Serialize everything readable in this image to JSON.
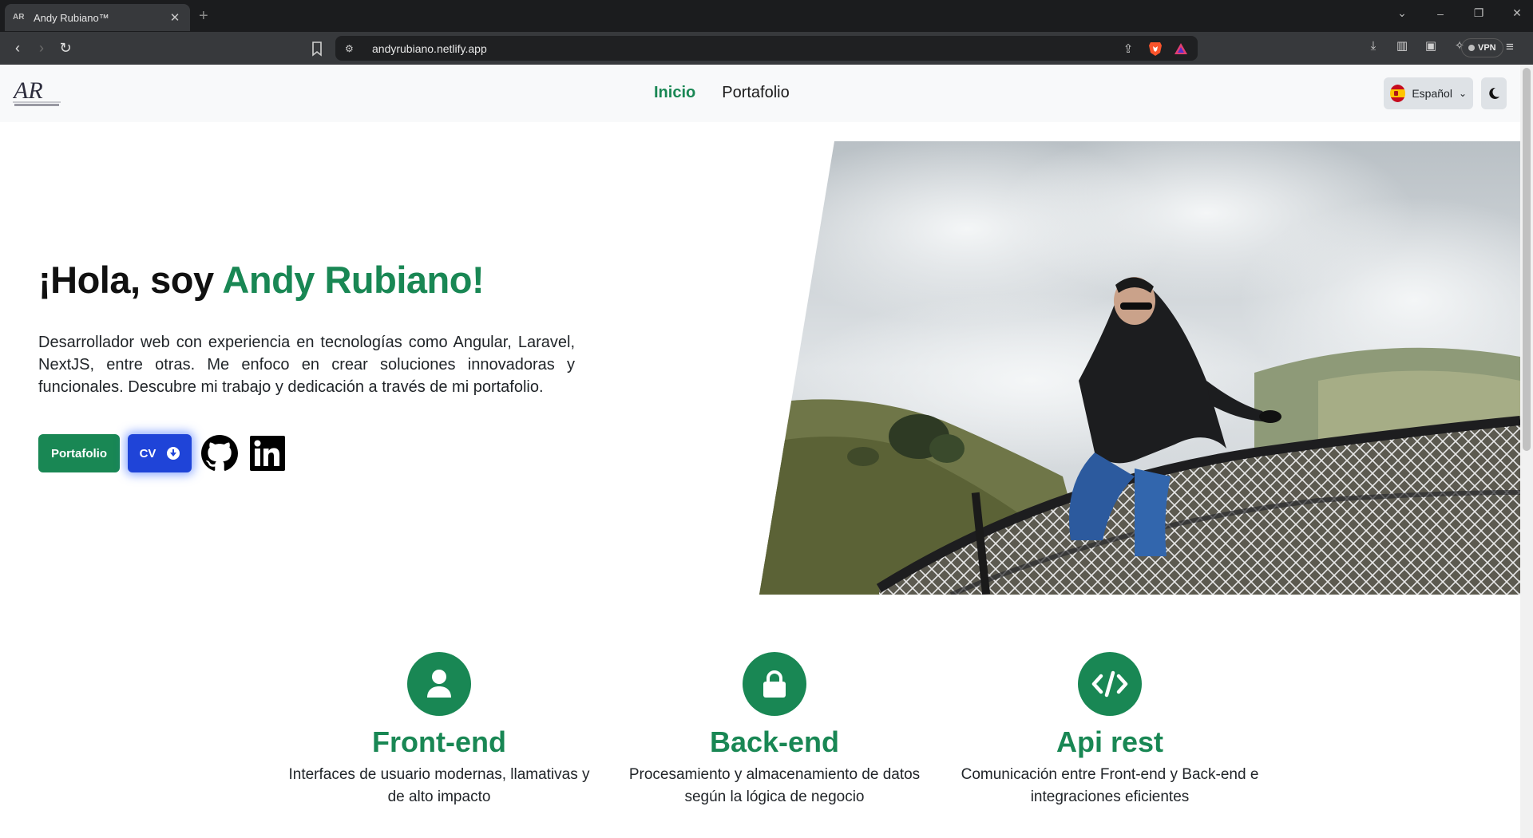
{
  "browser": {
    "tab_title": "Andy Rubiano™",
    "url": "andyrubiano.netlify.app",
    "vpn_label": "VPN"
  },
  "site": {
    "nav": {
      "items": [
        {
          "label": "Inicio",
          "active": true
        },
        {
          "label": "Portafolio",
          "active": false
        }
      ]
    },
    "language": {
      "selected": "Español"
    },
    "hero": {
      "title_prefix": "¡Hola, soy ",
      "title_name": "Andy Rubiano!",
      "description": "Desarrollador web con experiencia en tecnologías como Angular, Laravel, NextJS, entre otras. Me enfoco en crear soluciones innovadoras y funcionales. Descubre mi trabajo y dedicación a través de mi portafolio.",
      "portfolio_button": "Portafolio",
      "cv_button": "CV"
    },
    "features": [
      {
        "icon": "user-icon",
        "title": "Front-end",
        "description": "Interfaces de usuario modernas, llamativas y de alto impacto"
      },
      {
        "icon": "lock-icon",
        "title": "Back-end",
        "description": "Procesamiento y almacenamiento de datos según la lógica de negocio"
      },
      {
        "icon": "code-icon",
        "title": "Api rest",
        "description": "Comunicación entre Front-end y Back-end e integraciones eficientes"
      }
    ],
    "colors": {
      "accent": "#198754",
      "cv_button": "#1f44d8",
      "navbar_bg": "#f8f9fa"
    }
  }
}
